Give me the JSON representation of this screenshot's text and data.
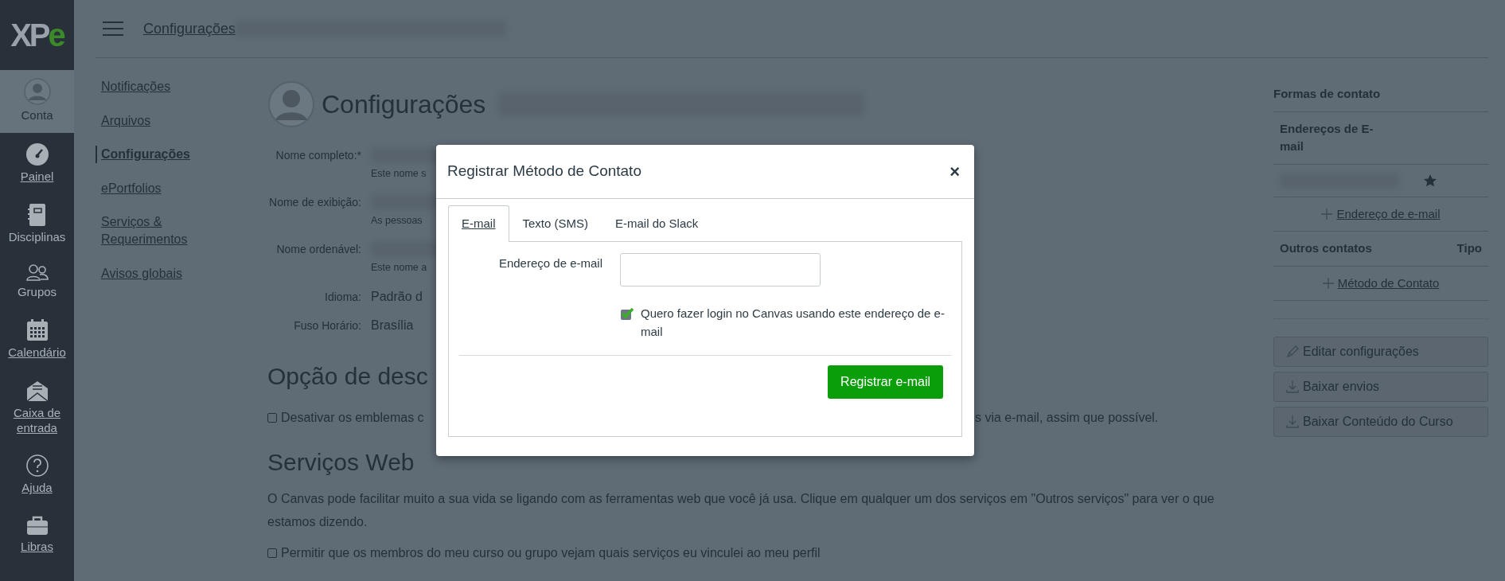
{
  "logo": {
    "text": "XP",
    "accent": "e"
  },
  "nav_items": [
    {
      "label": "Conta",
      "kind": "account",
      "selected": true,
      "underlined": false
    },
    {
      "label": "Painel",
      "kind": "dashboard",
      "selected": false,
      "underlined": true
    },
    {
      "label": "Disciplinas",
      "kind": "courses",
      "selected": false,
      "underlined": false
    },
    {
      "label": "Grupos",
      "kind": "groups",
      "selected": false,
      "underlined": false
    },
    {
      "label": "Calendário",
      "kind": "calendar",
      "selected": false,
      "underlined": true
    },
    {
      "label": "Caixa de entrada",
      "kind": "inbox",
      "selected": false,
      "underlined": true
    },
    {
      "label": "Ajuda",
      "kind": "help",
      "selected": false,
      "underlined": true
    },
    {
      "label": "Libras",
      "kind": "briefcase",
      "selected": false,
      "underlined": true
    }
  ],
  "breadcrumb": "Configurações",
  "settings_menu": [
    {
      "label": "Notificações",
      "selected": false
    },
    {
      "label": "Arquivos",
      "selected": false
    },
    {
      "label": "Configurações",
      "selected": true
    },
    {
      "label": "ePortfolios",
      "selected": false
    },
    {
      "label": "Serviços & Requerimentos",
      "selected": false
    },
    {
      "label": "Avisos globais",
      "selected": false
    }
  ],
  "profile": {
    "heading": "Configurações",
    "fields": [
      {
        "label": "Nome completo:*",
        "hint": "Este nome s"
      },
      {
        "label": "Nome de exibição:",
        "hint": "As pessoas"
      },
      {
        "label": "Nome ordenável:",
        "hint": "Este nome a"
      },
      {
        "label": "Idioma:",
        "value": "Padrão d"
      },
      {
        "label": "Fuso Horário:",
        "value": "Brasília"
      }
    ]
  },
  "notification_section": {
    "heading": "Opção de desc",
    "option": {
      "text_before": "Desativar os emblemas c",
      "text_after": "s via e-mail, assim que possível.",
      "checked": false
    }
  },
  "web_services": {
    "heading": "Serviços Web",
    "description": "O Canvas pode facilitar muito a sua vida se ligando com as ferramentas web que você já usa. Clique em qualquer um dos serviços em \"Outros serviços\" para ver o que estamos dizendo.",
    "option": {
      "text": "Permitir que os membros do meu curso ou grupo vejam quais serviços eu vinculei ao meu perfil",
      "checked": false
    }
  },
  "contacts": {
    "title": "Formas de contato",
    "email_header": "Endereços de E-mail",
    "add_email": "Endereço de e-mail",
    "others_header": "Outros contatos",
    "type_header": "Tipo",
    "add_method": "Método de Contato"
  },
  "actions": [
    {
      "label": "Editar configurações",
      "kind": "edit"
    },
    {
      "label": "Baixar envios",
      "kind": "download"
    },
    {
      "label": "Baixar Conteúdo do Curso",
      "kind": "download"
    }
  ],
  "dialog": {
    "title": "Registrar Método de Contato",
    "close": "×",
    "tabs": [
      {
        "label": "E-mail",
        "selected": true
      },
      {
        "label": "Texto (SMS)",
        "selected": false
      },
      {
        "label": "E-mail do Slack",
        "selected": false
      }
    ],
    "field_label": "Endereço de e-mail",
    "login_option": {
      "text": "Quero fazer login no Canvas usando este endereço de e-mail",
      "checked": true
    },
    "submit": "Registrar e-mail"
  }
}
